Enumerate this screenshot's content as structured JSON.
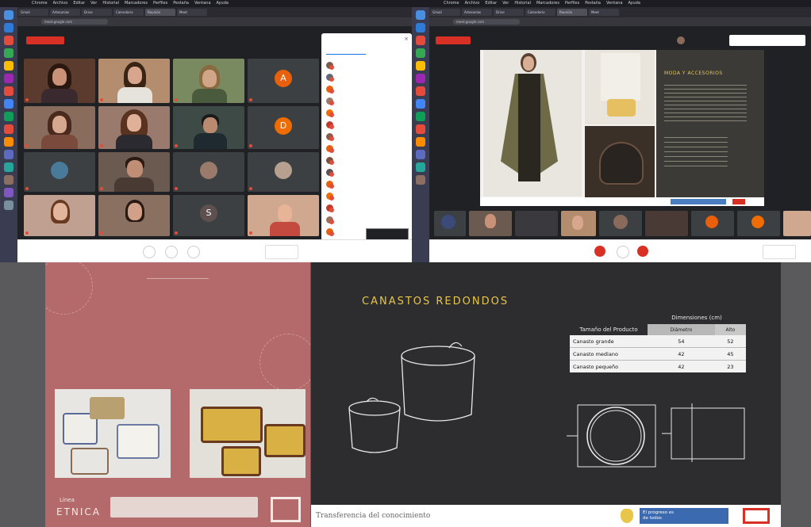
{
  "top_left": {
    "menubar": [
      "Chrome",
      "Archivo",
      "Editar",
      "Ver",
      "Historial",
      "Marcadores",
      "Perfiles",
      "Pestaña",
      "Ventana",
      "Ayuda"
    ],
    "tabs": [
      "Gmail",
      "Artesanías",
      "Drive",
      "Calendario",
      "Reunión",
      "Meet"
    ],
    "url": "meet.google.com",
    "recording_badge": "",
    "panel_title": "",
    "panel_tabs": [
      "",
      ""
    ],
    "tiles": [
      {
        "name": "",
        "kind": "video"
      },
      {
        "name": "",
        "kind": "video"
      },
      {
        "name": "",
        "kind": "video"
      },
      {
        "name": "",
        "kind": "video"
      },
      {
        "name": "",
        "kind": "avatar",
        "letter": "A",
        "color": "#e8600c"
      },
      {
        "name": "",
        "kind": "video"
      },
      {
        "name": "",
        "kind": "video"
      },
      {
        "name": "",
        "kind": "video"
      },
      {
        "name": "",
        "kind": "avatar",
        "letter": "D",
        "color": "#ef6c00"
      },
      {
        "name": "",
        "kind": "video"
      },
      {
        "name": "",
        "kind": "video"
      },
      {
        "name": "",
        "kind": "video"
      },
      {
        "name": "",
        "kind": "video"
      },
      {
        "name": "",
        "kind": "video"
      },
      {
        "name": "",
        "kind": "video"
      },
      {
        "name": "",
        "kind": "avatar",
        "letter": "S",
        "color": "#5f5050"
      },
      {
        "name": "",
        "kind": "video"
      }
    ],
    "participants": [
      "",
      "",
      "",
      "",
      "",
      "",
      "",
      "",
      "",
      "",
      "",
      "",
      "",
      "",
      ""
    ],
    "meeting_label": ""
  },
  "top_right": {
    "menubar": [
      "Chrome",
      "Archivo",
      "Editar",
      "Ver",
      "Historial",
      "Marcadores",
      "Perfiles",
      "Pestaña",
      "Ventana",
      "Ayuda"
    ],
    "tabs": [
      "Gmail",
      "Artesanías",
      "Drive",
      "Calendario",
      "Reunión",
      "Meet"
    ],
    "url": "meet.google.com",
    "recording_badge": "",
    "presenter": "",
    "slide_title": "MODA Y ACCESORIOS",
    "meeting_label": ""
  },
  "invitation": {
    "heading": "",
    "title": "",
    "subtitle": "",
    "date": "",
    "time": "",
    "brand_top": "Línea",
    "brand_bottom": "ETNICA",
    "footer_text": ""
  },
  "board": {
    "title": "CANASTOS REDONDOS",
    "table_header": "Tamaño del Producto",
    "table_group": "Dimensiones (cm)",
    "table_sub": [
      "Diámetro",
      "Alto"
    ],
    "rows": [
      {
        "name": "Canasto grande",
        "d": "54",
        "h": "52"
      },
      {
        "name": "Canasto mediano",
        "d": "42",
        "h": "45"
      },
      {
        "name": "Canasto pequeño",
        "d": "42",
        "h": "23"
      }
    ],
    "footer": "Transferencia del conocimiento",
    "footer_logo": "El progreso es de todos",
    "colors": {
      "title": "#e8c64a",
      "chalk": "#e8e8e8"
    }
  }
}
